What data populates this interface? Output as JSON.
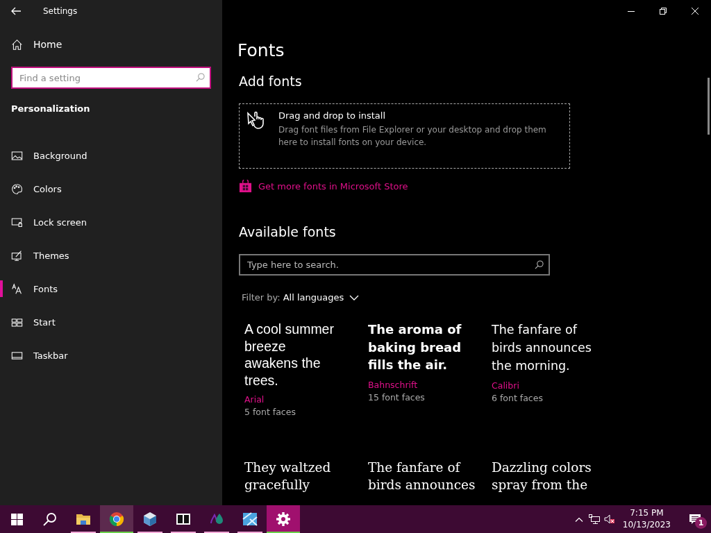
{
  "window": {
    "title": "Settings"
  },
  "sidebar": {
    "home": "Home",
    "search": {
      "placeholder": "Find a setting"
    },
    "section": "Personalization",
    "items": [
      {
        "label": "Background",
        "selected": false
      },
      {
        "label": "Colors",
        "selected": false
      },
      {
        "label": "Lock screen",
        "selected": false
      },
      {
        "label": "Themes",
        "selected": false
      },
      {
        "label": "Fonts",
        "selected": true
      },
      {
        "label": "Start",
        "selected": false
      },
      {
        "label": "Taskbar",
        "selected": false
      }
    ]
  },
  "page": {
    "title": "Fonts",
    "add_heading": "Add fonts",
    "drop_zone": {
      "title": "Drag and drop to install",
      "description": "Drag font files from File Explorer or your desktop and drop them here to install fonts on your device."
    },
    "store_link": "Get more fonts in Microsoft Store",
    "available_heading": "Available fonts",
    "search": {
      "placeholder": "Type here to search."
    },
    "filter": {
      "label": "Filter by:",
      "value": "All languages"
    },
    "fonts": [
      {
        "preview": "A cool summer\nbreeze\nawakens the\ntrees.",
        "name": "Arial",
        "faces": "5 font faces"
      },
      {
        "preview": "The aroma of\nbaking bread\nfills the air.",
        "name": "Bahnschrift",
        "faces": "15 font faces"
      },
      {
        "preview": "The fanfare of\nbirds announces\nthe morning.",
        "name": "Calibri",
        "faces": "6 font faces"
      },
      {
        "preview": "They waltzed\ngracefully"
      },
      {
        "preview": "The fanfare of\nbirds announces"
      },
      {
        "preview": "Dazzling colors\nspray from the"
      }
    ]
  },
  "taskbar": {
    "apps": [
      {
        "kind": "explorer",
        "running": true,
        "selected": false
      },
      {
        "kind": "browser",
        "running": true,
        "selected": true
      },
      {
        "kind": "cube",
        "running": true,
        "selected": false
      },
      {
        "kind": "archiver",
        "running": true,
        "selected": false
      },
      {
        "kind": "paint3d",
        "running": true,
        "selected": false
      },
      {
        "kind": "tool",
        "running": true,
        "selected": false
      },
      {
        "kind": "settings",
        "running": true,
        "selected": true
      }
    ],
    "time": "7:15 PM",
    "date": "10/13/2023",
    "notifications": "1"
  }
}
